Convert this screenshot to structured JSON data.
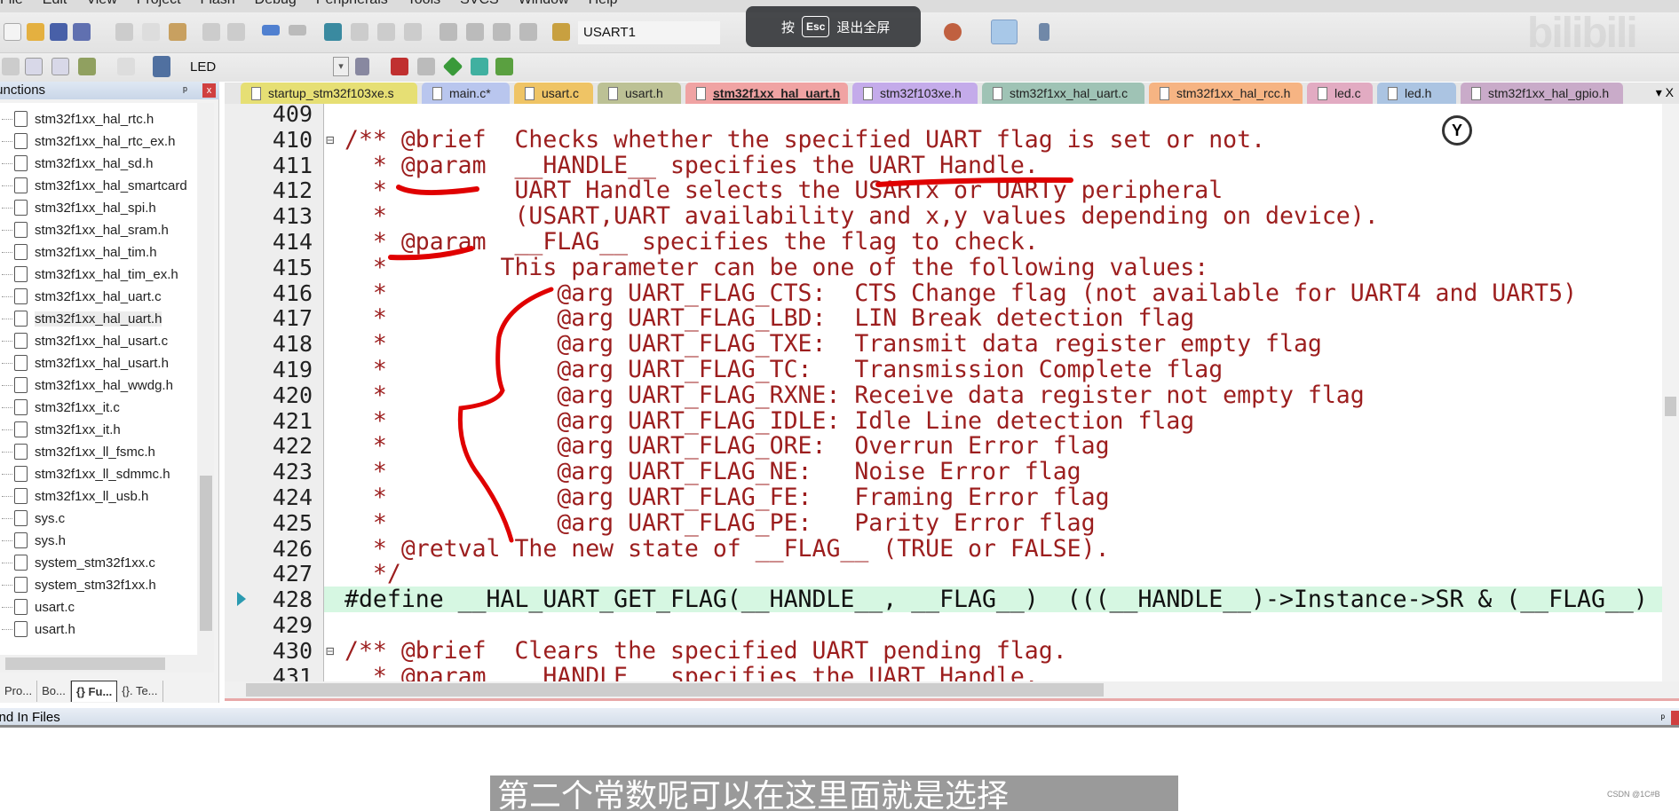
{
  "menu": [
    "File",
    "Edit",
    "View",
    "Project",
    "Flash",
    "Debug",
    "Peripherals",
    "Tools",
    "SVCS",
    "Window",
    "Help"
  ],
  "toolbar": {
    "target_combo": "USART1",
    "project_combo": "LED"
  },
  "overlay": {
    "prefix": "按",
    "key": "Esc",
    "text": "退出全屏"
  },
  "watermark": "bilibili",
  "functions_panel": {
    "title": "Functions",
    "pin": "ᵖ",
    "close": "x",
    "files": [
      "stm32f1xx_hal_rtc.h",
      "stm32f1xx_hal_rtc_ex.h",
      "stm32f1xx_hal_sd.h",
      "stm32f1xx_hal_smartcard",
      "stm32f1xx_hal_spi.h",
      "stm32f1xx_hal_sram.h",
      "stm32f1xx_hal_tim.h",
      "stm32f1xx_hal_tim_ex.h",
      "stm32f1xx_hal_uart.c",
      "stm32f1xx_hal_uart.h",
      "stm32f1xx_hal_usart.c",
      "stm32f1xx_hal_usart.h",
      "stm32f1xx_hal_wwdg.h",
      "stm32f1xx_it.c",
      "stm32f1xx_it.h",
      "stm32f1xx_ll_fsmc.h",
      "stm32f1xx_ll_sdmmc.h",
      "stm32f1xx_ll_usb.h",
      "sys.c",
      "sys.h",
      "system_stm32f1xx.c",
      "system_stm32f1xx.h",
      "usart.c",
      "usart.h"
    ],
    "selected": "stm32f1xx_hal_uart.h",
    "bottom_tabs": [
      "Pro...",
      "Bo...",
      "{} Fu...",
      "{}. Te..."
    ]
  },
  "editor": {
    "tabs": [
      {
        "label": "startup_stm32f103xe.s",
        "color": "#e6df74"
      },
      {
        "label": "main.c*",
        "color": "#b9c6ee"
      },
      {
        "label": "usart.c",
        "color": "#efc465"
      },
      {
        "label": "usart.h",
        "color": "#bcc195"
      },
      {
        "label": "stm32f1xx_hal_uart.h",
        "color": "#f0a3a3",
        "active": true
      },
      {
        "label": "stm32f103xe.h",
        "color": "#c4abea"
      },
      {
        "label": "stm32f1xx_hal_uart.c",
        "color": "#9fc3b5"
      },
      {
        "label": "stm32f1xx_hal_rcc.h",
        "color": "#f6b483"
      },
      {
        "label": "led.c",
        "color": "#e2abc2"
      },
      {
        "label": "led.h",
        "color": "#abc4e2"
      },
      {
        "label": "stm32f1xx_hal_gpio.h",
        "color": "#c9abc9"
      }
    ],
    "tab_controls": "▾ X",
    "lines": [
      {
        "n": "409",
        "t": "",
        "k": "cmt"
      },
      {
        "n": "410",
        "t": "/** @brief  Checks whether the specified UART flag is set or not.",
        "k": "cmt"
      },
      {
        "n": "411",
        "t": "  * @param  __HANDLE__ specifies the UART Handle.",
        "k": "cmt"
      },
      {
        "n": "412",
        "t": "  *         UART Handle selects the USARTx or UARTy peripheral",
        "k": "cmt"
      },
      {
        "n": "413",
        "t": "  *         (USART,UART availability and x,y values depending on device).",
        "k": "cmt"
      },
      {
        "n": "414",
        "t": "  * @param  __FLAG__ specifies the flag to check.",
        "k": "cmt"
      },
      {
        "n": "415",
        "t": "  *        This parameter can be one of the following values:",
        "k": "cmt"
      },
      {
        "n": "416",
        "t": "  *            @arg UART_FLAG_CTS:  CTS Change flag (not available for UART4 and UART5)",
        "k": "cmt"
      },
      {
        "n": "417",
        "t": "  *            @arg UART_FLAG_LBD:  LIN Break detection flag",
        "k": "cmt"
      },
      {
        "n": "418",
        "t": "  *            @arg UART_FLAG_TXE:  Transmit data register empty flag",
        "k": "cmt"
      },
      {
        "n": "419",
        "t": "  *            @arg UART_FLAG_TC:   Transmission Complete flag",
        "k": "cmt"
      },
      {
        "n": "420",
        "t": "  *            @arg UART_FLAG_RXNE: Receive data register not empty flag",
        "k": "cmt"
      },
      {
        "n": "421",
        "t": "  *            @arg UART_FLAG_IDLE: Idle Line detection flag",
        "k": "cmt"
      },
      {
        "n": "422",
        "t": "  *            @arg UART_FLAG_ORE:  Overrun Error flag",
        "k": "cmt"
      },
      {
        "n": "423",
        "t": "  *            @arg UART_FLAG_NE:   Noise Error flag",
        "k": "cmt"
      },
      {
        "n": "424",
        "t": "  *            @arg UART_FLAG_FE:   Framing Error flag",
        "k": "cmt"
      },
      {
        "n": "425",
        "t": "  *            @arg UART_FLAG_PE:   Parity Error flag",
        "k": "cmt"
      },
      {
        "n": "426",
        "t": "  * @retval The new state of __FLAG__ (TRUE or FALSE).",
        "k": "cmt"
      },
      {
        "n": "427",
        "t": "  */",
        "k": "cmt"
      },
      {
        "n": "428",
        "t": "#define __HAL_UART_GET_FLAG(__HANDLE__, __FLAG__)  (((__HANDLE__)->Instance->SR & (__FLAG__)",
        "k": "src",
        "current": true
      },
      {
        "n": "429",
        "t": "",
        "k": "src"
      },
      {
        "n": "430",
        "t": "/** @brief  Clears the specified UART pending flag.",
        "k": "cmt"
      },
      {
        "n": "431",
        "t": "  * @param  __HANDLE__ specifies the UART Handle.",
        "k": "cmt"
      }
    ]
  },
  "find_bar": {
    "title": "Find In Files"
  },
  "subtitle": "第二个常数呢可以在这里面就是选择",
  "csdn": "CSDN @1C#B"
}
